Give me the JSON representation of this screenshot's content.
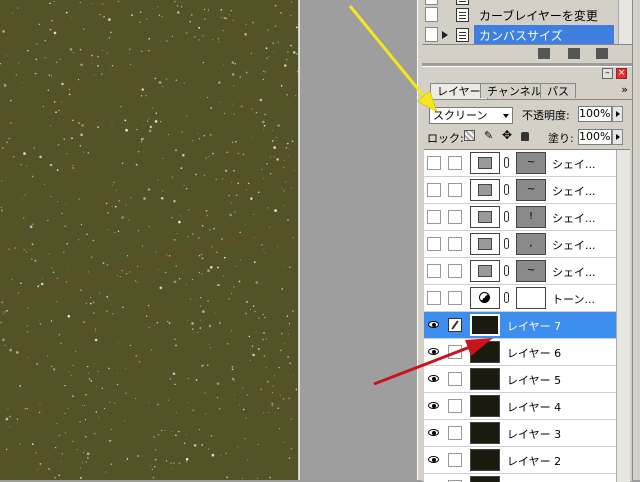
{
  "history": {
    "items": [
      {
        "label": "",
        "selected": false
      },
      {
        "label": "カーブレイヤーを変更",
        "selected": false
      },
      {
        "label": "カンバスサイズ",
        "selected": true
      }
    ],
    "icons": [
      "new-snapshot-icon",
      "camera-icon",
      "trash-icon"
    ]
  },
  "layers_panel": {
    "tabs": [
      {
        "label": "レイヤー",
        "active": true
      },
      {
        "label": "チャンネル",
        "active": false
      },
      {
        "label": "パス",
        "active": false
      }
    ],
    "more": "»",
    "blend_mode": "スクリーン",
    "opacity_label": "不透明度:",
    "opacity_value": "100%",
    "lock_label": "ロック:",
    "fill_label": "塗り:",
    "fill_value": "100%",
    "layers": [
      {
        "name": "シェイ...",
        "kind": "shape",
        "visible": false,
        "mask_glyph": "~"
      },
      {
        "name": "シェイ...",
        "kind": "shape",
        "visible": false,
        "mask_glyph": "~"
      },
      {
        "name": "シェイ...",
        "kind": "shape",
        "visible": false,
        "mask_glyph": "!"
      },
      {
        "name": "シェイ...",
        "kind": "shape",
        "visible": false,
        "mask_glyph": ","
      },
      {
        "name": "シェイ...",
        "kind": "shape",
        "visible": false,
        "mask_glyph": "~"
      },
      {
        "name": "トーン...",
        "kind": "adjustment",
        "visible": false,
        "mask_glyph": ""
      },
      {
        "name": "レイヤー 7",
        "kind": "pixel",
        "visible": true,
        "selected": true
      },
      {
        "name": "レイヤー 6",
        "kind": "pixel",
        "visible": true
      },
      {
        "name": "レイヤー 5",
        "kind": "pixel",
        "visible": true
      },
      {
        "name": "レイヤー 4",
        "kind": "pixel",
        "visible": true
      },
      {
        "name": "レイヤー 3",
        "kind": "pixel",
        "visible": true
      },
      {
        "name": "レイヤー 2",
        "kind": "pixel",
        "visible": true
      },
      {
        "name": "",
        "kind": "pixel",
        "visible": true
      }
    ]
  },
  "annotations": {
    "yellow_arrow_color": "#f4e81c",
    "red_arrow_color": "#c8141c"
  },
  "colors": {
    "selection": "#3e8ef0",
    "canvas": "#545327",
    "panel": "#d4d0c8"
  }
}
